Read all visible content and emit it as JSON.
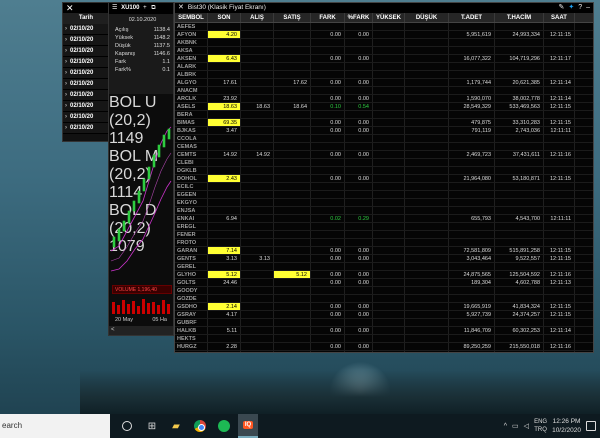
{
  "left_panel": {
    "close": "✕",
    "header": "Tarih",
    "rows": [
      "02/10/20",
      "02/10/20",
      "02/10/20",
      "02/10/20",
      "02/10/20",
      "02/10/20",
      "02/10/20",
      "02/10/20",
      "02/10/20",
      "02/10/20"
    ]
  },
  "chart": {
    "title": "XU100",
    "menu": "☰",
    "plus": "+",
    "date": "02.10.2020",
    "info": [
      {
        "label": "Açılış",
        "value": "1138.4"
      },
      {
        "label": "Yüksek",
        "value": "1148.2"
      },
      {
        "label": "Düşük",
        "value": "1137.5"
      },
      {
        "label": "Kapanış",
        "value": "1146.6"
      },
      {
        "label": "Fark",
        "value": "1.1"
      },
      {
        "label": "Fark%",
        "value": "0.1"
      }
    ],
    "legend": [
      "BOL U (20,2) 1149",
      "BOL M (20,2) 1114",
      "BOL D (20,2) 1079"
    ],
    "volume": "VOLUME 1,196,40",
    "axis": [
      "20 May",
      "05 Ha"
    ],
    "scroll_left": "<"
  },
  "bist": {
    "close": "✕",
    "title": "Bist30 (Klasik Fiyat Ekranı)",
    "columns": [
      "SEMBOL",
      "SON",
      "ALIŞ",
      "SATIŞ",
      "FARK",
      "%FARK",
      "YÜKSEK",
      "DÜŞÜK",
      "T.ADET",
      "T.HACİM",
      "SAAT"
    ],
    "rows": [
      [
        "AEFES",
        "",
        "",
        "",
        "",
        "",
        "",
        "",
        "",
        "",
        ""
      ],
      [
        "AFYON",
        "4.20",
        "",
        "",
        "0.00",
        "0.00",
        "",
        "",
        "5,951,619",
        "24,993,334",
        "12:11:15"
      ],
      [
        "AKBNK",
        "",
        "",
        "",
        "",
        "",
        "",
        "",
        "",
        "",
        ""
      ],
      [
        "AKSA",
        "",
        "",
        "",
        "",
        "",
        "",
        "",
        "",
        "",
        ""
      ],
      [
        "AKSEN",
        "6.43",
        "",
        "",
        "0.00",
        "0.00",
        "",
        "",
        "16,077,322",
        "104,719,296",
        "12:11:17"
      ],
      [
        "ALARK",
        "",
        "",
        "",
        "",
        "",
        "",
        "",
        "",
        "",
        ""
      ],
      [
        "ALBRK",
        "",
        "",
        "",
        "",
        "",
        "",
        "",
        "",
        "",
        ""
      ],
      [
        "ALGYO",
        "17.61",
        "",
        "17.62",
        "0.00",
        "0.00",
        "",
        "",
        "1,179,744",
        "20,621,385",
        "12:11:14"
      ],
      [
        "ANACM",
        "",
        "",
        "",
        "",
        "",
        "",
        "",
        "",
        "",
        ""
      ],
      [
        "ARCLK",
        "23.92",
        "",
        "",
        "0.00",
        "0.00",
        "",
        "",
        "1,590,070",
        "38,002,778",
        "12:11:14"
      ],
      [
        "ASELS",
        "18.63",
        "18.63",
        "18.64",
        "0.10",
        "0.54",
        "",
        "",
        "28,549,329",
        "533,469,563",
        "12:11:15"
      ],
      [
        "BERA",
        "",
        "",
        "",
        "",
        "",
        "",
        "",
        "",
        "",
        ""
      ],
      [
        "BIMAS",
        "69.35",
        "",
        "",
        "0.00",
        "0.00",
        "",
        "",
        "479,875",
        "33,310,283",
        "12:11:15"
      ],
      [
        "BJKAS",
        "3.47",
        "",
        "",
        "0.00",
        "0.00",
        "",
        "",
        "791,119",
        "2,743,036",
        "12:11:11"
      ],
      [
        "CCOLA",
        "",
        "",
        "",
        "",
        "",
        "",
        "",
        "",
        "",
        ""
      ],
      [
        "CEMAS",
        "",
        "",
        "",
        "",
        "",
        "",
        "",
        "",
        "",
        ""
      ],
      [
        "CEMTS",
        "14.92",
        "14.92",
        "",
        "0.00",
        "0.00",
        "",
        "",
        "2,469,723",
        "37,431,611",
        "12:11:16"
      ],
      [
        "CLEBI",
        "",
        "",
        "",
        "",
        "",
        "",
        "",
        "",
        "",
        ""
      ],
      [
        "DGKLB",
        "",
        "",
        "",
        "",
        "",
        "",
        "",
        "",
        "",
        ""
      ],
      [
        "DOHOL",
        "2.43",
        "",
        "",
        "0.00",
        "0.00",
        "",
        "",
        "21,964,080",
        "53,180,871",
        "12:11:15"
      ],
      [
        "ECILC",
        "",
        "",
        "",
        "",
        "",
        "",
        "",
        "",
        "",
        ""
      ],
      [
        "EGEEN",
        "",
        "",
        "",
        "",
        "",
        "",
        "",
        "",
        "",
        ""
      ],
      [
        "EKGYO",
        "",
        "",
        "",
        "",
        "",
        "",
        "",
        "",
        "",
        ""
      ],
      [
        "ENJSA",
        "",
        "",
        "",
        "",
        "",
        "",
        "",
        "",
        "",
        ""
      ],
      [
        "ENKAI",
        "6.94",
        "",
        "",
        "0.02",
        "0.29",
        "",
        "",
        "655,793",
        "4,543,700",
        "12:11:11"
      ],
      [
        "EREGL",
        "",
        "",
        "",
        "",
        "",
        "",
        "",
        "",
        "",
        ""
      ],
      [
        "FENER",
        "",
        "",
        "",
        "",
        "",
        "",
        "",
        "",
        "",
        ""
      ],
      [
        "FROTO",
        "",
        "",
        "",
        "",
        "",
        "",
        "",
        "",
        "",
        ""
      ],
      [
        "GARAN",
        "7.14",
        "",
        "",
        "0.00",
        "0.00",
        "",
        "",
        "72,581,809",
        "515,891,258",
        "12:11:15"
      ],
      [
        "GENTS",
        "3.13",
        "3.13",
        "",
        "0.00",
        "0.00",
        "",
        "",
        "3,043,464",
        "9,522,557",
        "12:11:15"
      ],
      [
        "GEREL",
        "",
        "",
        "",
        "",
        "",
        "",
        "",
        "",
        "",
        ""
      ],
      [
        "GLYHO",
        "5.12",
        "",
        "5.12",
        "0.00",
        "0.00",
        "",
        "",
        "24,875,565",
        "125,504,592",
        "12:11:16"
      ],
      [
        "GOLTS",
        "24.46",
        "",
        "",
        "0.00",
        "0.00",
        "",
        "",
        "189,304",
        "4,602,788",
        "12:11:13"
      ],
      [
        "GOODY",
        "",
        "",
        "",
        "",
        "",
        "",
        "",
        "",
        "",
        ""
      ],
      [
        "GOZDE",
        "",
        "",
        "",
        "",
        "",
        "",
        "",
        "",
        "",
        ""
      ],
      [
        "GSDHO",
        "2.14",
        "",
        "",
        "0.00",
        "0.00",
        "",
        "",
        "19,665,919",
        "41,834,324",
        "12:11:15"
      ],
      [
        "GSRAY",
        "4.17",
        "",
        "",
        "0.00",
        "0.00",
        "",
        "",
        "5,927,739",
        "24,374,257",
        "12:11:15"
      ],
      [
        "GUBRF",
        "",
        "",
        "",
        "",
        "",
        "",
        "",
        "",
        "",
        ""
      ],
      [
        "HALKB",
        "5.11",
        "",
        "",
        "0.00",
        "0.00",
        "",
        "",
        "11,846,709",
        "60,302,253",
        "12:11:14"
      ],
      [
        "HEKTS",
        "",
        "",
        "",
        "",
        "",
        "",
        "",
        "",
        "",
        ""
      ],
      [
        "HURGZ",
        "2.28",
        "",
        "",
        "0.00",
        "0.00",
        "",
        "",
        "89,250,259",
        "215,550,018",
        "12:11:16"
      ],
      [
        "ICBCT",
        "",
        "",
        "",
        "",
        "",
        "",
        "",
        "",
        "",
        ""
      ],
      [
        "IEYHO",
        "",
        "",
        "",
        "",
        "",
        "",
        "",
        "",
        "",
        ""
      ]
    ],
    "highlight": {
      "AFYON": [
        1
      ],
      "AKSEN": [
        1
      ],
      "ASELS": [
        1
      ],
      "BIMAS": [
        1
      ],
      "DOHOL": [
        1
      ],
      "GARAN": [
        1
      ],
      "GLYHO": [
        1,
        3
      ],
      "GSDHO": [
        1
      ]
    },
    "green": {
      "ASELS": [
        4,
        5
      ],
      "ENKAI": [
        4,
        5
      ]
    }
  },
  "taskbar": {
    "search": "earch",
    "lang": "ENG",
    "lang2": "TRQ",
    "time": "12:26 PM",
    "date": "10/2/2020"
  },
  "colors": {
    "highlight": "#ffff33",
    "positive": "#2ecc40",
    "volume": "#ff4444",
    "bollinger": "#cc33cc"
  }
}
